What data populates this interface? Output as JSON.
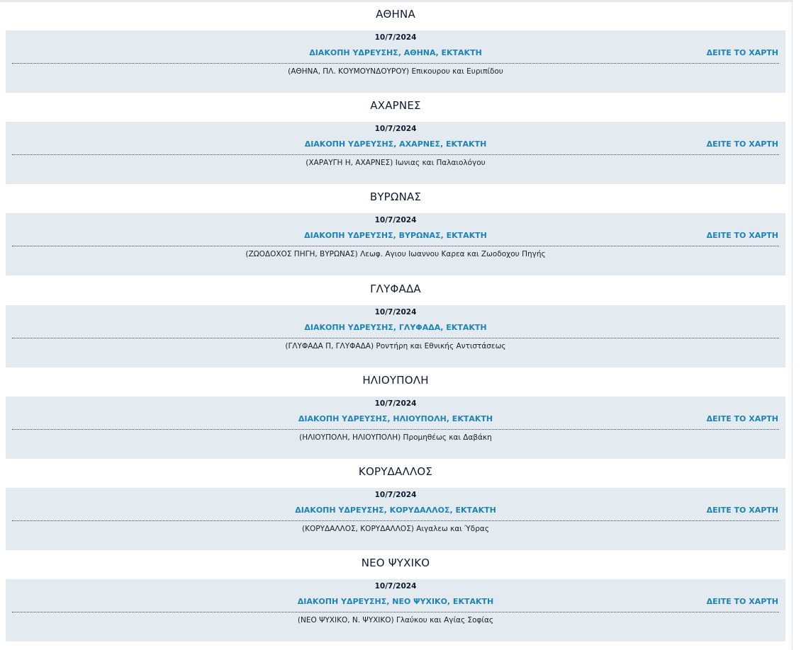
{
  "outages": [
    {
      "area": "ΑΘΗΝΑ",
      "date": "10/7/2024",
      "headline": "ΔΙΑΚΟΠΗ ΥΔΡΕΥΣΗΣ, ΑΘΗΝΑ, ΕΚΤΑΚΤΗ",
      "map_link": "ΔΕΙΤΕ ΤΟ ΧΑΡΤΗ",
      "details": "(ΑΘΗΝΑ, ΠΛ. ΚΟΥΜΟΥΝΔΟΥΡΟΥ) Επικουρου και Ευριπίδου"
    },
    {
      "area": "ΑΧΑΡΝΕΣ",
      "date": "10/7/2024",
      "headline": "ΔΙΑΚΟΠΗ ΥΔΡΕΥΣΗΣ, ΑΧΑΡΝΕΣ, ΕΚΤΑΚΤΗ",
      "map_link": "ΔΕΙΤΕ ΤΟ ΧΑΡΤΗ",
      "details": "(ΧΑΡΑΥΓΗ Η, ΑΧΑΡΝΕΣ) Ιωνιας και Παλαιολόγου"
    },
    {
      "area": "ΒΥΡΩΝΑΣ",
      "date": "10/7/2024",
      "headline": "ΔΙΑΚΟΠΗ ΥΔΡΕΥΣΗΣ, ΒΥΡΩΝΑΣ, ΕΚΤΑΚΤΗ",
      "map_link": "ΔΕΙΤΕ ΤΟ ΧΑΡΤΗ",
      "details": "(ΖΩΟΔΟΧΟΣ ΠΗΓΗ, ΒΥΡΩΝΑΣ) Λεωφ. Αγιου Ιωαννου Καρεα και Ζωοδοχου Πηγής"
    },
    {
      "area": "ΓΛΥΦΑΔΑ",
      "date": "10/7/2024",
      "headline": "ΔΙΑΚΟΠΗ ΥΔΡΕΥΣΗΣ, ΓΛΥΦΑΔΑ, ΕΚΤΑΚΤΗ",
      "map_link": "",
      "details": "(ΓΛΥΦΑΔΑ Π, ΓΛΥΦΑΔΑ) Ροντήρη και Εθνικής Αντιστάσεως"
    },
    {
      "area": "ΗΛΙΟΥΠΟΛΗ",
      "date": "10/7/2024",
      "headline": "ΔΙΑΚΟΠΗ ΥΔΡΕΥΣΗΣ, ΗΛΙΟΥΠΟΛΗ, ΕΚΤΑΚΤΗ",
      "map_link": "ΔΕΙΤΕ ΤΟ ΧΑΡΤΗ",
      "details": "(ΗΛΙΟΥΠΟΛΗ, ΗΛΙΟΥΠΟΛΗ) Προμηθέως και Δαβάκη"
    },
    {
      "area": "ΚΟΡΥΔΑΛΛΟΣ",
      "date": "10/7/2024",
      "headline": "ΔΙΑΚΟΠΗ ΥΔΡΕΥΣΗΣ, ΚΟΡΥΔΑΛΛΟΣ, ΕΚΤΑΚΤΗ",
      "map_link": "ΔΕΙΤΕ ΤΟ ΧΑΡΤΗ",
      "details": "(ΚΟΡΥΔΑΛΛΟΣ, ΚΟΡΥΔΑΛΛΟΣ) Αιγαλεω και Ύδρας"
    },
    {
      "area": "ΝΕΟ ΨΥΧΙΚΟ",
      "date": "10/7/2024",
      "headline": "ΔΙΑΚΟΠΗ ΥΔΡΕΥΣΗΣ, ΝΕΟ ΨΥΧΙΚΟ, ΕΚΤΑΚΤΗ",
      "map_link": "ΔΕΙΤΕ ΤΟ ΧΑΡΤΗ",
      "details": "(ΝΕΟ ΨΥΧΙΚΟ, Ν. ΨΥΧΙΚΟ) Γλαύκου και Αγίας Σοφίας"
    }
  ],
  "colors": {
    "card_background": "#e3eaf0",
    "link_blue": "#1d83b8",
    "heading_navy": "#0f1a2e"
  }
}
